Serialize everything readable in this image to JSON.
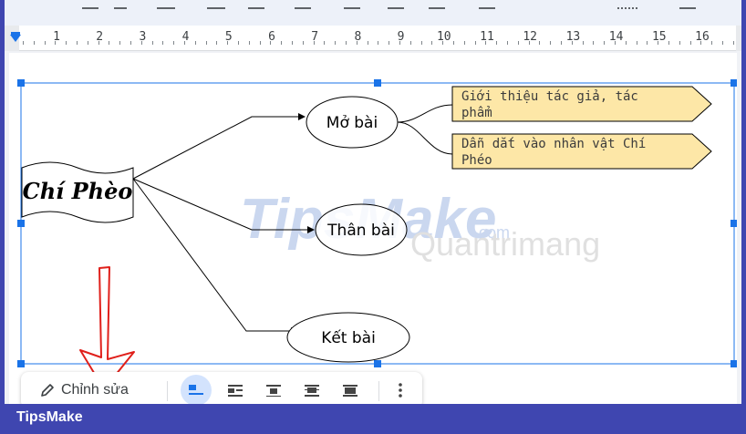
{
  "ruler": {
    "numbers": [
      "1",
      "2",
      "3",
      "4",
      "5",
      "6",
      "7",
      "8",
      "9",
      "10",
      "11",
      "12",
      "13",
      "14",
      "15",
      "16"
    ]
  },
  "drawing": {
    "main_title": "Chí Phèo",
    "branches": [
      "Mở bài",
      "Thân bài",
      "Kết bài"
    ],
    "intro_details": [
      "Giới thiệu tác giả, tác phẩm",
      "Dẫn dắt vào nhân vật Chí Phéo"
    ],
    "colors": {
      "detail_fill": "#fde7a7",
      "selection": "#1a73e8",
      "arrow_red": "#e0201b"
    }
  },
  "watermark": {
    "brand": "TipsMake",
    "domain": ".com",
    "site": "Quantrimang"
  },
  "float_toolbar": {
    "edit_label": "Chỉnh sửa",
    "icons": [
      "pencil-icon",
      "wrap-inline-icon",
      "wrap-text-icon",
      "break-text-icon",
      "behind-text-icon",
      "in-front-text-icon",
      "more-options-icon"
    ]
  },
  "footer": {
    "brand": "TipsMake"
  }
}
